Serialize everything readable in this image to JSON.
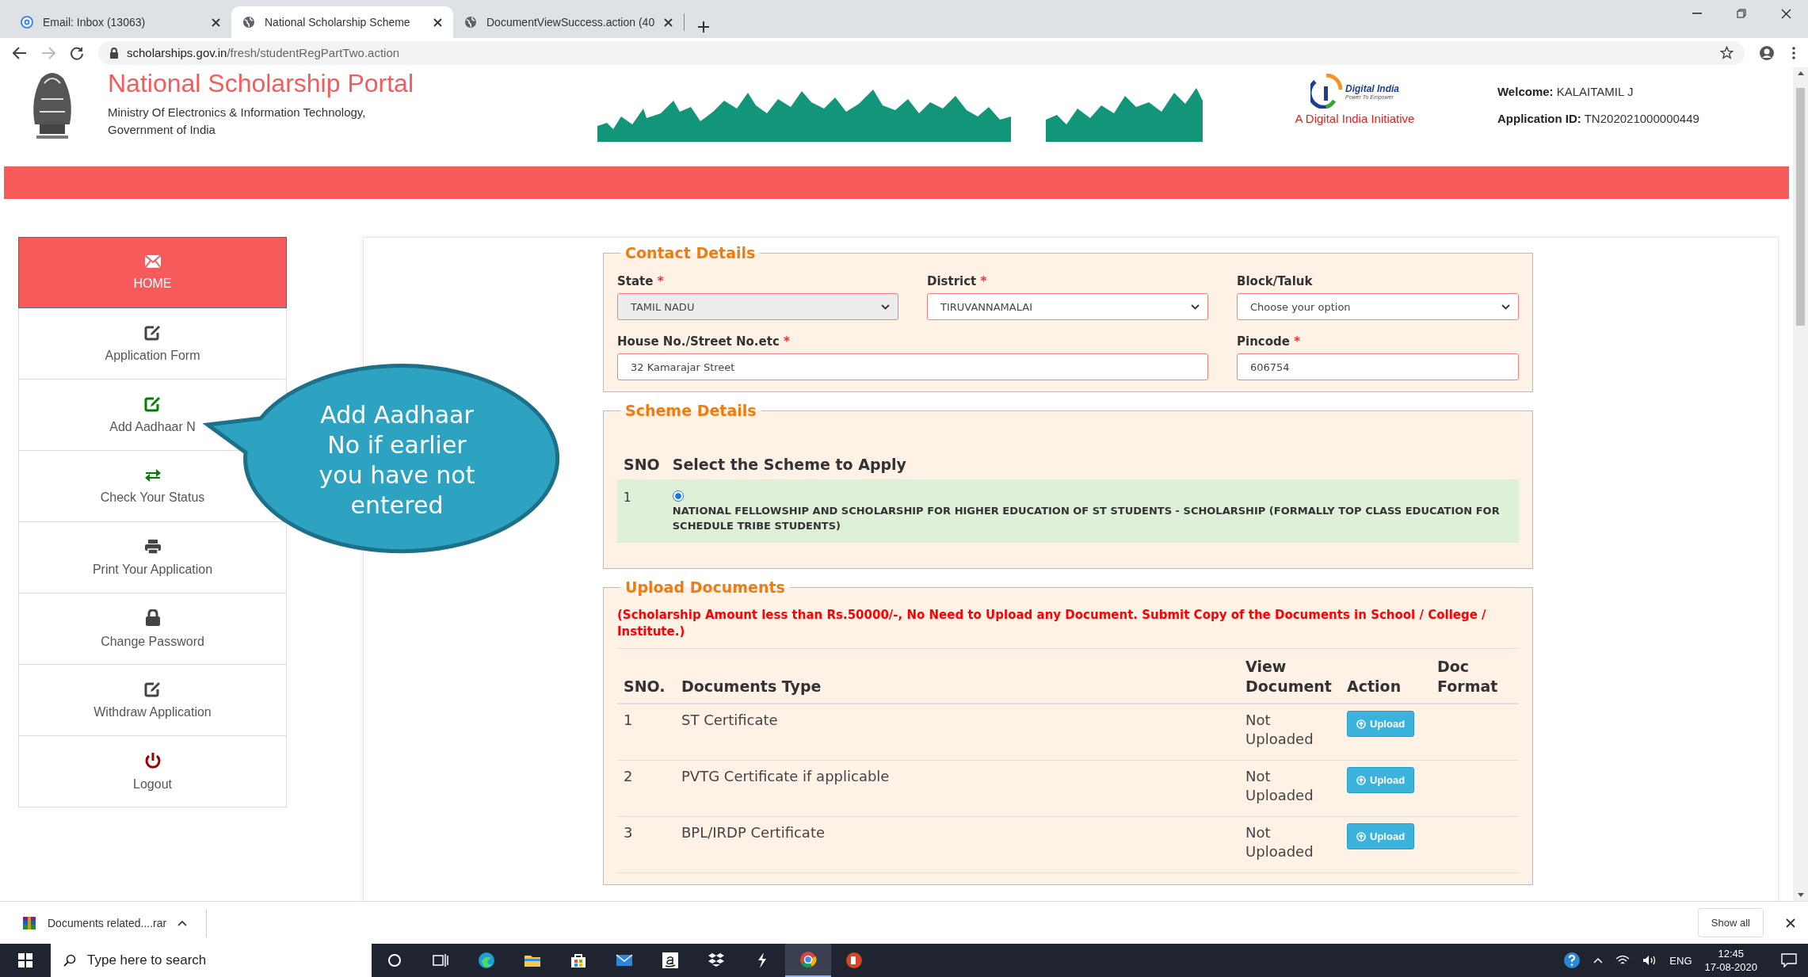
{
  "browser": {
    "tabs": [
      {
        "title": "Email: Inbox (13063)",
        "kind": "mail",
        "selected": false
      },
      {
        "title": "National Scholarship Scheme",
        "kind": "globe",
        "selected": true
      },
      {
        "title": "DocumentViewSuccess.action (40",
        "kind": "globe",
        "selected": false
      }
    ],
    "url_host": "scholarships.gov.in",
    "url_path": "/fresh/studentRegPartTwo.action"
  },
  "header": {
    "title": "National Scholarship Portal",
    "subtitle_lines": [
      "Ministry Of Electronics & Information Technology,",
      "Government of India"
    ],
    "digital_india": {
      "name": "Digital India",
      "tagline": "Power To Empower",
      "caption": "A Digital India Initiative"
    },
    "welcome_label": "Welcome:",
    "user_name": "KALAITAMIL J",
    "app_id_label": "Application ID:",
    "app_id": "TN202021000000449"
  },
  "sidebar": {
    "items": [
      {
        "label": "HOME",
        "kind": "envelope",
        "color": "#ffffff",
        "selected": true
      },
      {
        "label": "Application Form",
        "kind": "edit",
        "color": "#444444",
        "selected": false
      },
      {
        "label": "Add Aadhaar N",
        "kind": "edit",
        "color": "#008000",
        "selected": false
      },
      {
        "label": "Check Your Status",
        "kind": "swap",
        "color": "#008000",
        "selected": false
      },
      {
        "label": "Print Your Application",
        "kind": "print",
        "color": "#444444",
        "selected": false
      },
      {
        "label": "Change Password",
        "kind": "lock",
        "color": "#444444",
        "selected": false
      },
      {
        "label": "Withdraw Application",
        "kind": "edit",
        "color": "#444444",
        "selected": false
      },
      {
        "label": "Logout",
        "kind": "power",
        "color": "#990000",
        "selected": false
      }
    ]
  },
  "callout": {
    "text": "Add Aadhaar No if earlier you have not entered"
  },
  "contact": {
    "legend": "Contact Details",
    "fields": [
      {
        "label": "State",
        "required_mark": "*",
        "kind": "select",
        "value": "TAMIL NADU",
        "disabled": true
      },
      {
        "label": "District",
        "required_mark": "*",
        "kind": "select",
        "value": "TIRUVANNAMALAI",
        "disabled": false
      },
      {
        "label": "Block/Taluk",
        "kind": "select",
        "placeholder": "Choose your option",
        "disabled": false
      },
      {
        "label": "House No./Street No.etc",
        "required_mark": "*",
        "kind": "wide_text",
        "value": "32 Kamarajar Street"
      },
      {
        "label": "Pincode",
        "required_mark": "*",
        "kind": "text",
        "value": "606754"
      }
    ]
  },
  "scheme": {
    "legend": "Scheme Details",
    "columns": [
      "SNO",
      "Select the Scheme to Apply"
    ],
    "rows": [
      {
        "sno": "1",
        "name": "NATIONAL FELLOWSHIP AND SCHOLARSHIP FOR HIGHER EDUCATION OF ST STUDENTS - SCHOLARSHIP (FORMALLY TOP CLASS EDUCATION FOR SCHEDULE TRIBE STUDENTS)",
        "selected": true
      }
    ]
  },
  "documents": {
    "legend": "Upload Documents",
    "notice": "(Scholarship Amount less than Rs.50000/-, No Need to Upload any Document. Submit Copy of the Documents in School / College / Institute.)",
    "columns": [
      "SNO.",
      "Documents Type",
      "View Document",
      "Action",
      "Doc Format"
    ],
    "rows": [
      {
        "sno": "1",
        "type": "ST Certificate",
        "status": "Not Uploaded",
        "action": "Upload"
      },
      {
        "sno": "2",
        "type": "PVTG Certificate if applicable",
        "status": "Not Uploaded",
        "action": "Upload"
      },
      {
        "sno": "3",
        "type": "BPL/IRDP Certificate",
        "status": "Not Uploaded",
        "action": "Upload"
      }
    ]
  },
  "downloads": {
    "file": "Documents related....rar",
    "show_all": "Show all"
  },
  "taskbar": {
    "search_placeholder": "Type here to search",
    "language": "ENG",
    "time": "12:45",
    "date": "17-08-2020"
  }
}
